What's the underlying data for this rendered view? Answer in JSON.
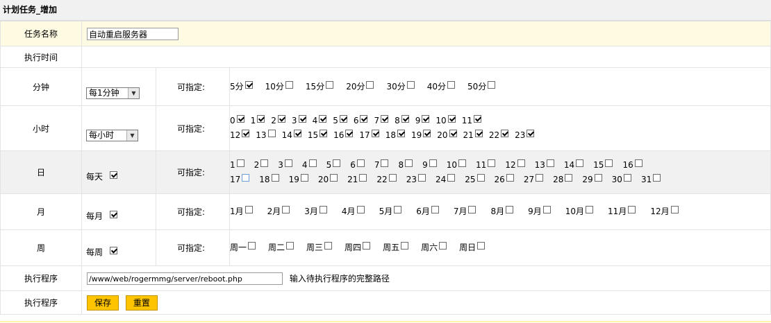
{
  "title": "计划任务_增加",
  "task_name": {
    "label": "任务名称",
    "value": "自动重启服务器"
  },
  "exec_time": {
    "label": "执行时间"
  },
  "specify_label": "可指定:",
  "minute": {
    "label": "分钟",
    "select": "每1分钟",
    "options": [
      {
        "text": "5分",
        "checked": true
      },
      {
        "text": "10分",
        "checked": false
      },
      {
        "text": "15分",
        "checked": false
      },
      {
        "text": "20分",
        "checked": false
      },
      {
        "text": "30分",
        "checked": false
      },
      {
        "text": "40分",
        "checked": false
      },
      {
        "text": "50分",
        "checked": false
      }
    ]
  },
  "hour": {
    "label": "小时",
    "select": "每小时",
    "options": [
      {
        "text": "0",
        "checked": true
      },
      {
        "text": "1",
        "checked": true
      },
      {
        "text": "2",
        "checked": true
      },
      {
        "text": "3",
        "checked": true
      },
      {
        "text": "4",
        "checked": true
      },
      {
        "text": "5",
        "checked": true
      },
      {
        "text": "6",
        "checked": true
      },
      {
        "text": "7",
        "checked": true
      },
      {
        "text": "8",
        "checked": true
      },
      {
        "text": "9",
        "checked": true
      },
      {
        "text": "10",
        "checked": true
      },
      {
        "text": "11",
        "checked": true
      },
      {
        "text": "12",
        "checked": true
      },
      {
        "text": "13",
        "checked": false
      },
      {
        "text": "14",
        "checked": true
      },
      {
        "text": "15",
        "checked": true
      },
      {
        "text": "16",
        "checked": true
      },
      {
        "text": "17",
        "checked": true
      },
      {
        "text": "18",
        "checked": true
      },
      {
        "text": "19",
        "checked": true
      },
      {
        "text": "20",
        "checked": true
      },
      {
        "text": "21",
        "checked": true
      },
      {
        "text": "22",
        "checked": true
      },
      {
        "text": "23",
        "checked": true
      }
    ]
  },
  "day": {
    "label": "日",
    "every_label": "每天",
    "every_checked": true,
    "options": [
      {
        "text": "1",
        "checked": false
      },
      {
        "text": "2",
        "checked": false
      },
      {
        "text": "3",
        "checked": false
      },
      {
        "text": "4",
        "checked": false
      },
      {
        "text": "5",
        "checked": false
      },
      {
        "text": "6",
        "checked": false
      },
      {
        "text": "7",
        "checked": false
      },
      {
        "text": "8",
        "checked": false
      },
      {
        "text": "9",
        "checked": false
      },
      {
        "text": "10",
        "checked": false
      },
      {
        "text": "11",
        "checked": false
      },
      {
        "text": "12",
        "checked": false
      },
      {
        "text": "13",
        "checked": false
      },
      {
        "text": "14",
        "checked": false
      },
      {
        "text": "15",
        "checked": false
      },
      {
        "text": "16",
        "checked": false
      },
      {
        "text": "17",
        "checked": false,
        "focused": true
      },
      {
        "text": "18",
        "checked": false
      },
      {
        "text": "19",
        "checked": false
      },
      {
        "text": "20",
        "checked": false
      },
      {
        "text": "21",
        "checked": false
      },
      {
        "text": "22",
        "checked": false
      },
      {
        "text": "23",
        "checked": false
      },
      {
        "text": "24",
        "checked": false
      },
      {
        "text": "25",
        "checked": false
      },
      {
        "text": "26",
        "checked": false
      },
      {
        "text": "27",
        "checked": false
      },
      {
        "text": "28",
        "checked": false
      },
      {
        "text": "29",
        "checked": false
      },
      {
        "text": "30",
        "checked": false
      },
      {
        "text": "31",
        "checked": false
      }
    ]
  },
  "month": {
    "label": "月",
    "every_label": "每月",
    "every_checked": true,
    "options": [
      {
        "text": "1月",
        "checked": false
      },
      {
        "text": "2月",
        "checked": false
      },
      {
        "text": "3月",
        "checked": false
      },
      {
        "text": "4月",
        "checked": false
      },
      {
        "text": "5月",
        "checked": false
      },
      {
        "text": "6月",
        "checked": false
      },
      {
        "text": "7月",
        "checked": false
      },
      {
        "text": "8月",
        "checked": false
      },
      {
        "text": "9月",
        "checked": false
      },
      {
        "text": "10月",
        "checked": false
      },
      {
        "text": "11月",
        "checked": false
      },
      {
        "text": "12月",
        "checked": false
      }
    ]
  },
  "week": {
    "label": "周",
    "every_label": "每周",
    "every_checked": true,
    "options": [
      {
        "text": "周一",
        "checked": false
      },
      {
        "text": "周二",
        "checked": false
      },
      {
        "text": "周三",
        "checked": false
      },
      {
        "text": "周四",
        "checked": false
      },
      {
        "text": "周五",
        "checked": false
      },
      {
        "text": "周六",
        "checked": false
      },
      {
        "text": "周日",
        "checked": false
      }
    ]
  },
  "program": {
    "label": "执行程序",
    "value": "/www/web/rogermmg/server/reboot.php",
    "hint": "输入待执行程序的完整路径"
  },
  "actions": {
    "label": "执行程序",
    "save": "保存",
    "reset": "重置"
  }
}
